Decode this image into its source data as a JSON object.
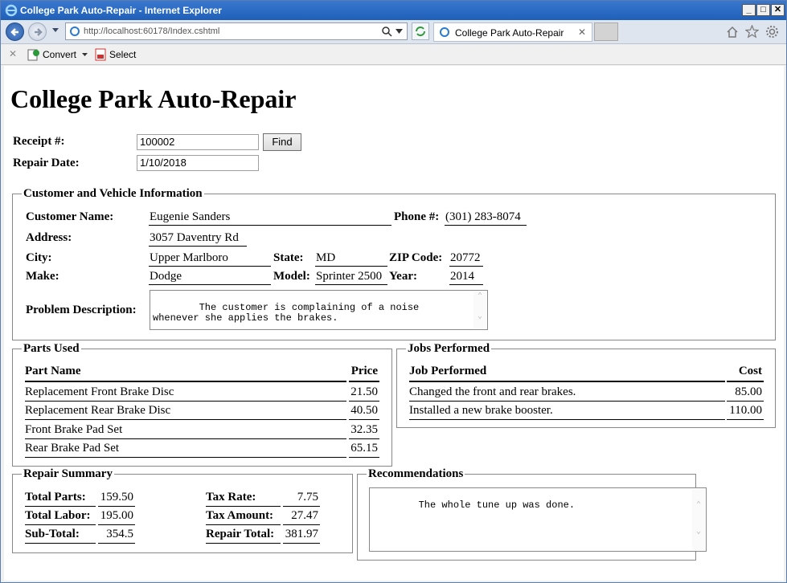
{
  "browser": {
    "window_title": "College Park Auto-Repair - Internet Explorer",
    "url": "http://localhost:60178/Index.cshtml",
    "tab_title": "College Park Auto-Repair",
    "convert_label": "Convert",
    "select_label": "Select"
  },
  "page": {
    "title": "College Park Auto-Repair",
    "receipt_label": "Receipt #:",
    "receipt_value": "100002",
    "find_label": "Find",
    "repair_date_label": "Repair Date:",
    "repair_date_value": "1/10/2018"
  },
  "customer": {
    "legend": "Customer and Vehicle Information",
    "name_label": "Customer Name:",
    "name": "Eugenie Sanders",
    "phone_label": "Phone #:",
    "phone": "(301) 283-8074",
    "address_label": "Address:",
    "address": "3057 Daventry Rd",
    "city_label": "City:",
    "city": "Upper Marlboro",
    "state_label": "State:",
    "state": "MD",
    "zip_label": "ZIP Code:",
    "zip": "20772",
    "make_label": "Make:",
    "make": "Dodge",
    "model_label": "Model:",
    "model": "Sprinter 2500",
    "year_label": "Year:",
    "year": "2014",
    "problem_label": "Problem Description:",
    "problem": "The customer is complaining of a noise whenever she applies the brakes."
  },
  "parts": {
    "legend": "Parts Used",
    "col_name": "Part Name",
    "col_price": "Price",
    "rows": [
      {
        "name": "Replacement Front Brake Disc",
        "price": "21.50"
      },
      {
        "name": "Replacement Rear Brake Disc",
        "price": "40.50"
      },
      {
        "name": "Front Brake Pad Set",
        "price": "32.35"
      },
      {
        "name": "Rear Brake Pad Set",
        "price": "65.15"
      }
    ]
  },
  "jobs": {
    "legend": "Jobs Performed",
    "col_job": "Job Performed",
    "col_cost": "Cost",
    "rows": [
      {
        "job": "Changed the front and rear brakes.",
        "cost": "85.00"
      },
      {
        "job": "Installed a new brake booster.",
        "cost": "110.00"
      }
    ]
  },
  "summary": {
    "legend": "Repair Summary",
    "total_parts_label": "Total Parts:",
    "total_parts": "159.50",
    "total_labor_label": "Total Labor:",
    "total_labor": "195.00",
    "subtotal_label": "Sub-Total:",
    "subtotal": "354.5",
    "tax_rate_label": "Tax Rate:",
    "tax_rate": "7.75",
    "tax_amount_label": "Tax Amount:",
    "tax_amount": "27.47",
    "repair_total_label": "Repair Total:",
    "repair_total": "381.97"
  },
  "recommendations": {
    "legend": "Recommendations",
    "text": "The whole tune up was done."
  }
}
